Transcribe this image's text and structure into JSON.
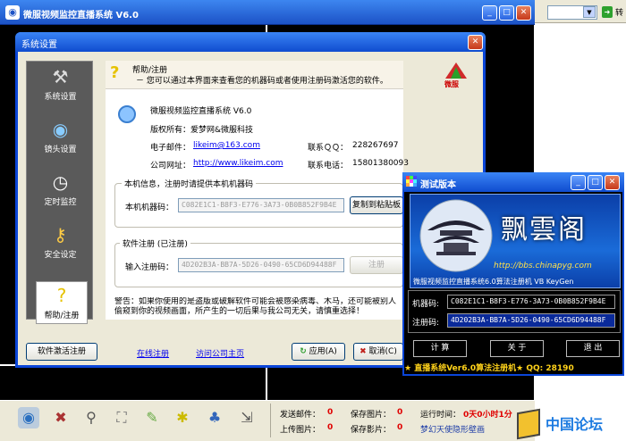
{
  "main": {
    "title": "微服视频监控直播系统 V6.0"
  },
  "top_right": {
    "go_label": "转"
  },
  "settings": {
    "title": "系统设置",
    "nav": [
      {
        "label": "系统设置"
      },
      {
        "label": "镜头设置"
      },
      {
        "label": "定时监控"
      },
      {
        "label": "安全设定"
      },
      {
        "label": "帮助/注册"
      }
    ],
    "help_title": "帮助/注册",
    "help_desc": "－ 您可以通过本界面来查看您的机器码或者使用注册码激活您的软件。",
    "logo_text": "微服",
    "product": "微服视频监控直播系统 V6.0",
    "copyright": "版权所有：爱梦网&微服科技",
    "email_label": "电子邮件：",
    "email": "likeim@163.com",
    "qq_label": "联系ＱＱ：",
    "qq": "228267697",
    "site_label": "公司网址：",
    "site": "http://www.likeim.com",
    "phone_label": "联系电话：",
    "phone": "15801380093",
    "machine_group": "本机信息，注册时请提供本机机器码",
    "machine_label": "本机机器码：",
    "machine_code": "C082E1C1-B8F3-E776-3A73-0B0B852F9B4E",
    "copy_btn": "复制到粘贴板",
    "reg_group": "软件注册 (已注册)",
    "reg_label": "输入注册码：",
    "reg_code": "4D202B3A-BB7A-5D26-0490-65CD6D94488F",
    "reg_btn": "注册",
    "warning": "警告：如果你使用的是盗版或破解软件可能会被感染病毒、木马，还可能被别人偷窥到你的视频画面，所产生的一切后果与我公司无关，请慎重选择！",
    "activate_btn": "软件激活注册",
    "online_reg": "在线注册",
    "visit_home": "访问公司主页",
    "apply_btn": "应用(A)",
    "cancel_btn": "取消(C)"
  },
  "keygen": {
    "title": "测试版本",
    "banner_name": "飘雲阁",
    "banner_url": "http://bbs.chinapyg.com",
    "banner_sub": "微服视频监控直播系统6.0算法注册机 VB KeyGen",
    "machine_label": "机器码:",
    "machine_code": "C082E1C1-B8F3-E776-3A73-0B0B852F9B4E",
    "reg_label": "注册码:",
    "reg_code": "4D202B3A-BB7A-5D26-0490-65CD6D94488F",
    "btn_calc": "计 算",
    "btn_about": "关 于",
    "btn_exit": "退 出",
    "ticker": "★ 直播系统Ver6.0算法注册机★ QQ: 28190"
  },
  "status": {
    "sent_mail_label": "发送邮件：",
    "sent_mail": "0",
    "save_img_label": "保存图片：",
    "save_img": "0",
    "run_time_label": "运行时间：",
    "run_time": "0天0小时1分",
    "upload_label": "上传图片：",
    "upload": "0",
    "save_video_label": "保存影片：",
    "save_video": "0",
    "wallpaper": "梦幻天使隐形壁画"
  },
  "watermark": "中国论坛",
  "colors": {
    "accent": "#0a45d8",
    "status_red": "#e00000"
  }
}
